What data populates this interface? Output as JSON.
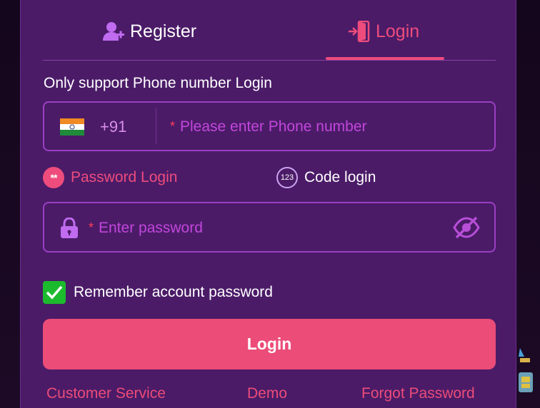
{
  "tabs": {
    "register_label": "Register",
    "login_label": "Login",
    "active": "login"
  },
  "login_form": {
    "hint": "Only support Phone number Login",
    "phone": {
      "country_code": "+91",
      "required_mark": "*",
      "placeholder": "Please enter Phone number",
      "value": ""
    },
    "modes": {
      "password_label": "Password Login",
      "password_icon_text": "**",
      "code_label": "Code login",
      "code_icon_text": "123",
      "active": "password"
    },
    "password": {
      "required_mark": "*",
      "placeholder": "Enter password",
      "value": ""
    },
    "remember": {
      "label": "Remember account password",
      "checked": true
    },
    "submit_label": "Login"
  },
  "footer": {
    "customer_service": "Customer Service",
    "demo": "Demo",
    "forgot_password": "Forgot Password"
  },
  "icons": {
    "register": "user-add-icon",
    "login": "door-enter-icon",
    "flag": "india-flag-icon",
    "lock": "lock-icon",
    "eye": "eye-slash-icon",
    "check": "checkmark-icon"
  },
  "colors": {
    "panel_bg": "#4b1b68",
    "accent": "#ec4c78",
    "field_border": "#9b3fc4",
    "placeholder": "#c246db",
    "checkbox": "#1cba2d"
  }
}
